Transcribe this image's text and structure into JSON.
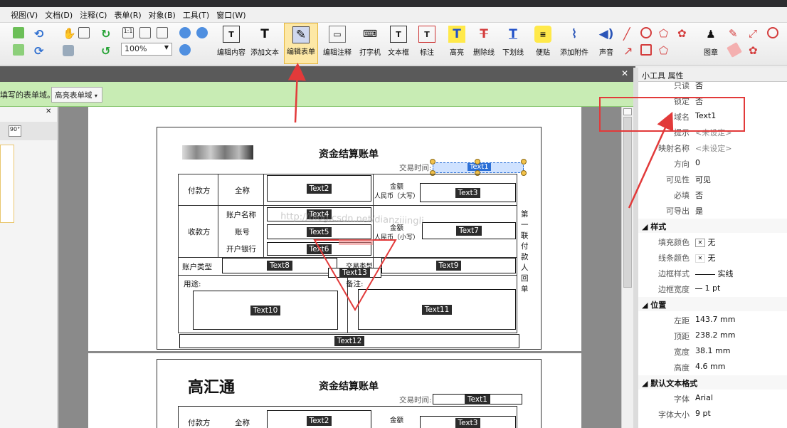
{
  "menu": {
    "items": [
      "视图(V)",
      "文档(D)",
      "注释(C)",
      "表单(R)",
      "对象(B)",
      "工具(T)",
      "窗口(W)"
    ]
  },
  "toolbar": {
    "zoom": "100%",
    "tools": [
      {
        "label": "编辑内容",
        "icon": "edit-content-icon"
      },
      {
        "label": "添加文本",
        "icon": "add-text-icon"
      },
      {
        "label": "编辑表单",
        "icon": "edit-form-icon"
      },
      {
        "label": "编辑注释",
        "icon": "edit-annotation-icon"
      },
      {
        "label": "打字机",
        "icon": "typewriter-icon"
      },
      {
        "label": "文本框",
        "icon": "textbox-icon"
      },
      {
        "label": "标注",
        "icon": "callout-icon"
      },
      {
        "label": "高亮",
        "icon": "highlight-icon"
      },
      {
        "label": "删除线",
        "icon": "strikethrough-icon"
      },
      {
        "label": "下划线",
        "icon": "underline-icon"
      },
      {
        "label": "便贴",
        "icon": "sticky-note-icon"
      },
      {
        "label": "添加附件",
        "icon": "attachment-icon"
      },
      {
        "label": "声音",
        "icon": "sound-icon"
      },
      {
        "label": "图章",
        "icon": "stamp-icon"
      }
    ]
  },
  "formbar": {
    "hint": "填写的表单域。",
    "highlight_label": "高亮表单域"
  },
  "rightpane": {
    "title": "小工具 属性",
    "props_top": [
      {
        "k": "只读",
        "v": "否"
      },
      {
        "k": "锁定",
        "v": "否"
      },
      {
        "k": "域名",
        "v": "Text1"
      },
      {
        "k": "提示",
        "v": "<未设定>"
      },
      {
        "k": "映射名称",
        "v": "<未设定>"
      },
      {
        "k": "方向",
        "v": "0"
      },
      {
        "k": "可见性",
        "v": "可见"
      },
      {
        "k": "必填",
        "v": "否"
      },
      {
        "k": "可导出",
        "v": "是"
      }
    ],
    "sections": {
      "style": "样式",
      "position": "位置",
      "default_text": "默认文本格式"
    },
    "props_style": [
      {
        "k": "填充颜色",
        "v": "无"
      },
      {
        "k": "线条颜色",
        "v": "无"
      },
      {
        "k": "边框样式",
        "v": "实线"
      },
      {
        "k": "边框宽度",
        "v": "1 pt"
      }
    ],
    "props_position": [
      {
        "k": "左距",
        "v": "143.7 mm"
      },
      {
        "k": "顶距",
        "v": "238.2 mm"
      },
      {
        "k": "宽度",
        "v": "38.1 mm"
      },
      {
        "k": "高度",
        "v": "4.6 mm"
      }
    ],
    "props_text": [
      {
        "k": "字体",
        "v": "Arial"
      },
      {
        "k": "字体大小",
        "v": "9 pt"
      }
    ]
  },
  "doc": {
    "title": "资金结算账单",
    "time_label": "交易时间:",
    "brand": "高汇通",
    "rows": {
      "payer": "付款方",
      "fullname": "全称",
      "amount": "金额",
      "rmb_upper": "人民币（大写）",
      "payee": "收款方",
      "acct_name": "账户名称",
      "acct_no": "账号",
      "bank": "开户银行",
      "rmb_lower": "人民币（小写）",
      "acct_type": "账户类型",
      "trade_type": "交易类型",
      "purpose": "用途:",
      "remark": "备注:",
      "side_note": "第一联付款人回单"
    },
    "fields": [
      "Text1",
      "Text2",
      "Text3",
      "Text4",
      "Text5",
      "Text6",
      "Text7",
      "Text8",
      "Text9",
      "Text10",
      "Text11",
      "Text12",
      "Text13"
    ],
    "watermark": "http://blog.csdn.net/dianziiingli"
  },
  "colors": {
    "accent_red": "#e23a3a",
    "green_bar": "#c8ecb4",
    "selection_blue": "#2b6fd6"
  }
}
